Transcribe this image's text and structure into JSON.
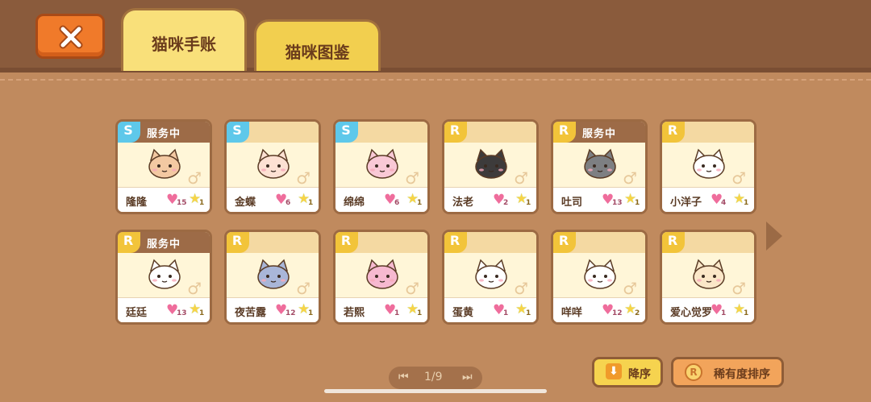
{
  "header": {
    "tabs": [
      {
        "label": "猫咪手账",
        "active": true
      },
      {
        "label": "猫咪图鉴",
        "active": false
      }
    ],
    "close_icon": "close-x-icon"
  },
  "cards": [
    {
      "rarity": "S",
      "status": "服务中",
      "name": "隆隆",
      "hearts": "15",
      "stars": "1",
      "face": "#f3c9a2"
    },
    {
      "rarity": "S",
      "status": "",
      "name": "金蝶",
      "hearts": "6",
      "stars": "1",
      "face": "#fde1d3"
    },
    {
      "rarity": "S",
      "status": "",
      "name": "绵绵",
      "hearts": "6",
      "stars": "1",
      "face": "#f9c9d6"
    },
    {
      "rarity": "R",
      "status": "",
      "name": "法老",
      "hearts": "2",
      "stars": "1",
      "face": "#3d3b3b"
    },
    {
      "rarity": "R",
      "status": "服务中",
      "name": "吐司",
      "hearts": "13",
      "stars": "1",
      "face": "#7d7f82"
    },
    {
      "rarity": "R",
      "status": "",
      "name": "小洋子",
      "hearts": "4",
      "stars": "1",
      "face": "#ffffff"
    },
    {
      "rarity": "R",
      "status": "服务中",
      "name": "廷廷",
      "hearts": "13",
      "stars": "1",
      "face": "#ffffff"
    },
    {
      "rarity": "R",
      "status": "",
      "name": "夜苦露",
      "hearts": "12",
      "stars": "1",
      "face": "#a9b6d8"
    },
    {
      "rarity": "R",
      "status": "",
      "name": "若熙",
      "hearts": "1",
      "stars": "1",
      "face": "#f6b9d0"
    },
    {
      "rarity": "R",
      "status": "",
      "name": "蛋黄",
      "hearts": "1",
      "stars": "1",
      "face": "#ffffff"
    },
    {
      "rarity": "R",
      "status": "",
      "name": "咩咩",
      "hearts": "12",
      "stars": "2",
      "face": "#ffffff"
    },
    {
      "rarity": "R",
      "status": "",
      "name": "爱心觉罗",
      "hearts": "1",
      "stars": "1",
      "face": "#fbe7c8"
    }
  ],
  "pager": {
    "label": "1/9",
    "first_icon": "first-page-icon",
    "last_icon": "last-page-icon"
  },
  "sort": {
    "desc_label": "降序",
    "desc_icon": "arrow-down-icon",
    "rarity_label": "稀有度排序",
    "rarity_icon": "rarity-r-icon",
    "rarity_icon_text": "R"
  },
  "gender_symbol": "♂",
  "colors": {
    "rarity_S": "#5ec8ea",
    "rarity_R": "#f2c43a",
    "heart": "#ef6d9c",
    "star": "#f7d447",
    "background": "#c08a5e",
    "topbar": "#8a5b3c"
  }
}
